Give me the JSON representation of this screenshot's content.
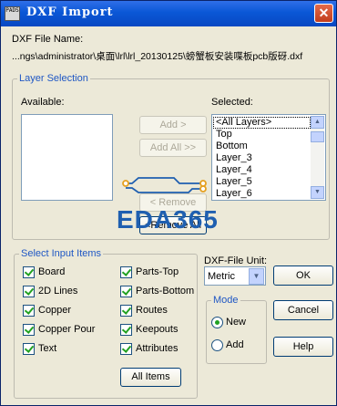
{
  "window": {
    "title": "DXF Import",
    "app_icon_text": "PADS",
    "close_glyph": "✕"
  },
  "file": {
    "label": "DXF File Name:",
    "path": "...ngs\\administrator\\桌面\\lrl\\lrl_20130125\\螃蟹板安装喋板pcb版砑.dxf"
  },
  "layer_selection": {
    "legend": "Layer Selection",
    "available_label": "Available:",
    "selected_label": "Selected:",
    "available_items": [],
    "selected_items": [
      "<All Layers>",
      "Top",
      "Bottom",
      "Layer_3",
      "Layer_4",
      "Layer_5",
      "Layer_6"
    ],
    "buttons": {
      "add": "Add >",
      "add_all": "Add All >>",
      "remove": "< Remove",
      "remove_all": "<Remove All"
    }
  },
  "watermark": {
    "text": "EDA365",
    "color": "#1f5fb0",
    "accent": "#e5a020"
  },
  "input_items": {
    "legend": "Select Input Items",
    "left": [
      {
        "label": "Board",
        "checked": true
      },
      {
        "label": "2D Lines",
        "checked": true
      },
      {
        "label": "Copper",
        "checked": true
      },
      {
        "label": "Copper Pour",
        "checked": true
      },
      {
        "label": "Text",
        "checked": true
      }
    ],
    "right": [
      {
        "label": "Parts-Top",
        "checked": true
      },
      {
        "label": "Parts-Bottom",
        "checked": true
      },
      {
        "label": "Routes",
        "checked": true
      },
      {
        "label": "Keepouts",
        "checked": true
      },
      {
        "label": "Attributes",
        "checked": true
      }
    ],
    "all_items_button": "All Items"
  },
  "unit": {
    "label": "DXF-File Unit:",
    "value": "Metric",
    "arrow": "▼"
  },
  "mode": {
    "legend": "Mode",
    "options": [
      {
        "label": "New",
        "selected": true
      },
      {
        "label": "Add",
        "selected": false
      }
    ]
  },
  "actions": {
    "ok": "OK",
    "cancel": "Cancel",
    "help": "Help"
  },
  "scroll": {
    "up": "▲",
    "down": "▼"
  }
}
